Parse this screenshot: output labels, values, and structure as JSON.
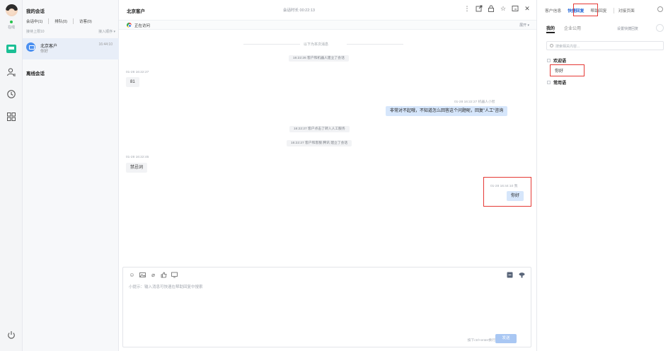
{
  "rail": {
    "status": "在线",
    "accent": "#1bbf95"
  },
  "list": {
    "title": "我的会话",
    "tabs": [
      "会话中(1)",
      "排队(0)",
      "访客(0)"
    ],
    "limit": "接待上限10",
    "sort": "接入顺序 ▾",
    "conversation": {
      "name": "北京客户",
      "preview": "你好",
      "time": "16:44:10"
    },
    "offline_title": "离线会话"
  },
  "chat": {
    "title": "北京客户",
    "duration": "会话时长 00:22:13",
    "visit_status": "正在访问",
    "expand": "展开 ▾",
    "divider": "以下为本次消息",
    "messages": [
      {
        "type": "system",
        "text": "16:22:26 客户和机器人建立了会话"
      },
      {
        "type": "left",
        "meta": "01-28 16:22:27",
        "text": "81"
      },
      {
        "type": "right",
        "meta": "01-28 16:22:27  机器人小智",
        "text": "非常对不起哦，不知道怎么回答这个问题呢，回复\"人工\"咨询"
      },
      {
        "type": "system",
        "text": "16:22:27 客户点击了转入人工服务"
      },
      {
        "type": "system",
        "text": "16:22:27 客户和客服 腾讯 建立了会话"
      },
      {
        "type": "left",
        "meta": "01-28 16:22:45",
        "text": "禁忌词"
      },
      {
        "type": "right",
        "meta": "01-28 16:44:10  我",
        "text": "你好"
      }
    ],
    "composer": {
      "placeholder": "小提示：输入消息可快速在帮助回复中搜索",
      "hint": "按下ctrl+enter换行",
      "send": "发送"
    }
  },
  "panel": {
    "tabs": [
      "客户信息",
      "快捷回复",
      "帮助回复",
      "对接页面"
    ],
    "active_tab": "快捷回复",
    "subtabs": [
      "我的",
      "企业公用"
    ],
    "set_quick": "设置快捷回复",
    "search_placeholder": "搜索相关内容...",
    "groups": [
      {
        "name": "欢迎语",
        "items": [
          "你好"
        ]
      },
      {
        "name": "常用语",
        "items": []
      }
    ]
  }
}
